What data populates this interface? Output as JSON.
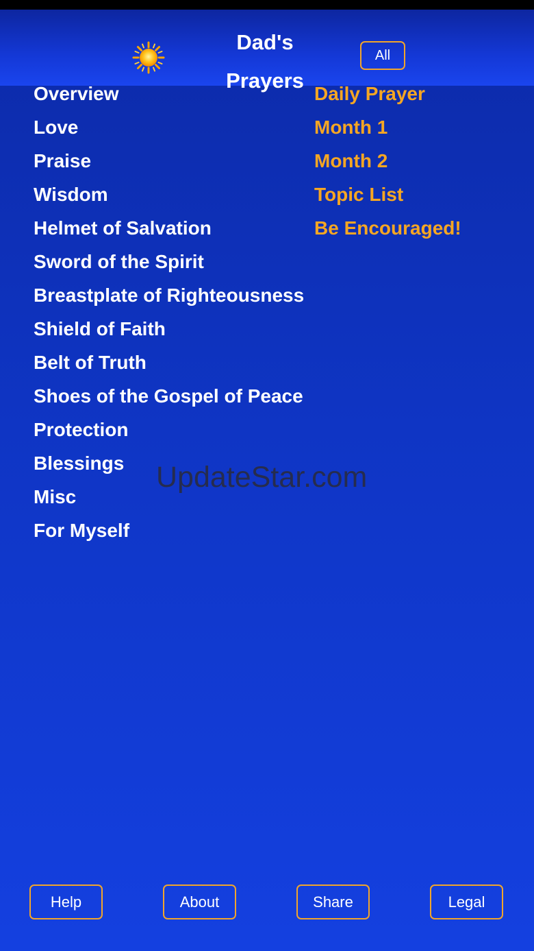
{
  "header": {
    "title_line1": "Dad's",
    "title_line2": "Prayers",
    "sun_icon": "sun-icon",
    "all_button": "All"
  },
  "topics": [
    "Overview",
    "Love",
    "Praise",
    "Wisdom",
    "Helmet of Salvation",
    "Sword of the Spirit",
    "Breastplate of Righteousness",
    "Shield of Faith",
    "Belt of Truth",
    "Shoes of the Gospel of Peace",
    "Protection",
    "Blessings",
    "Misc",
    "For Myself"
  ],
  "links": [
    "Daily Prayer",
    "Month 1",
    "Month 2",
    "Topic List",
    "Be Encouraged!"
  ],
  "watermark": "UpdateStar.com",
  "footer": {
    "help": "Help",
    "about": "About",
    "share": "Share",
    "legal": "Legal"
  },
  "colors": {
    "background": "#0f35c4",
    "topic_text": "#ffffff",
    "link_text": "#f5a623",
    "button_border": "#f2a52a"
  }
}
